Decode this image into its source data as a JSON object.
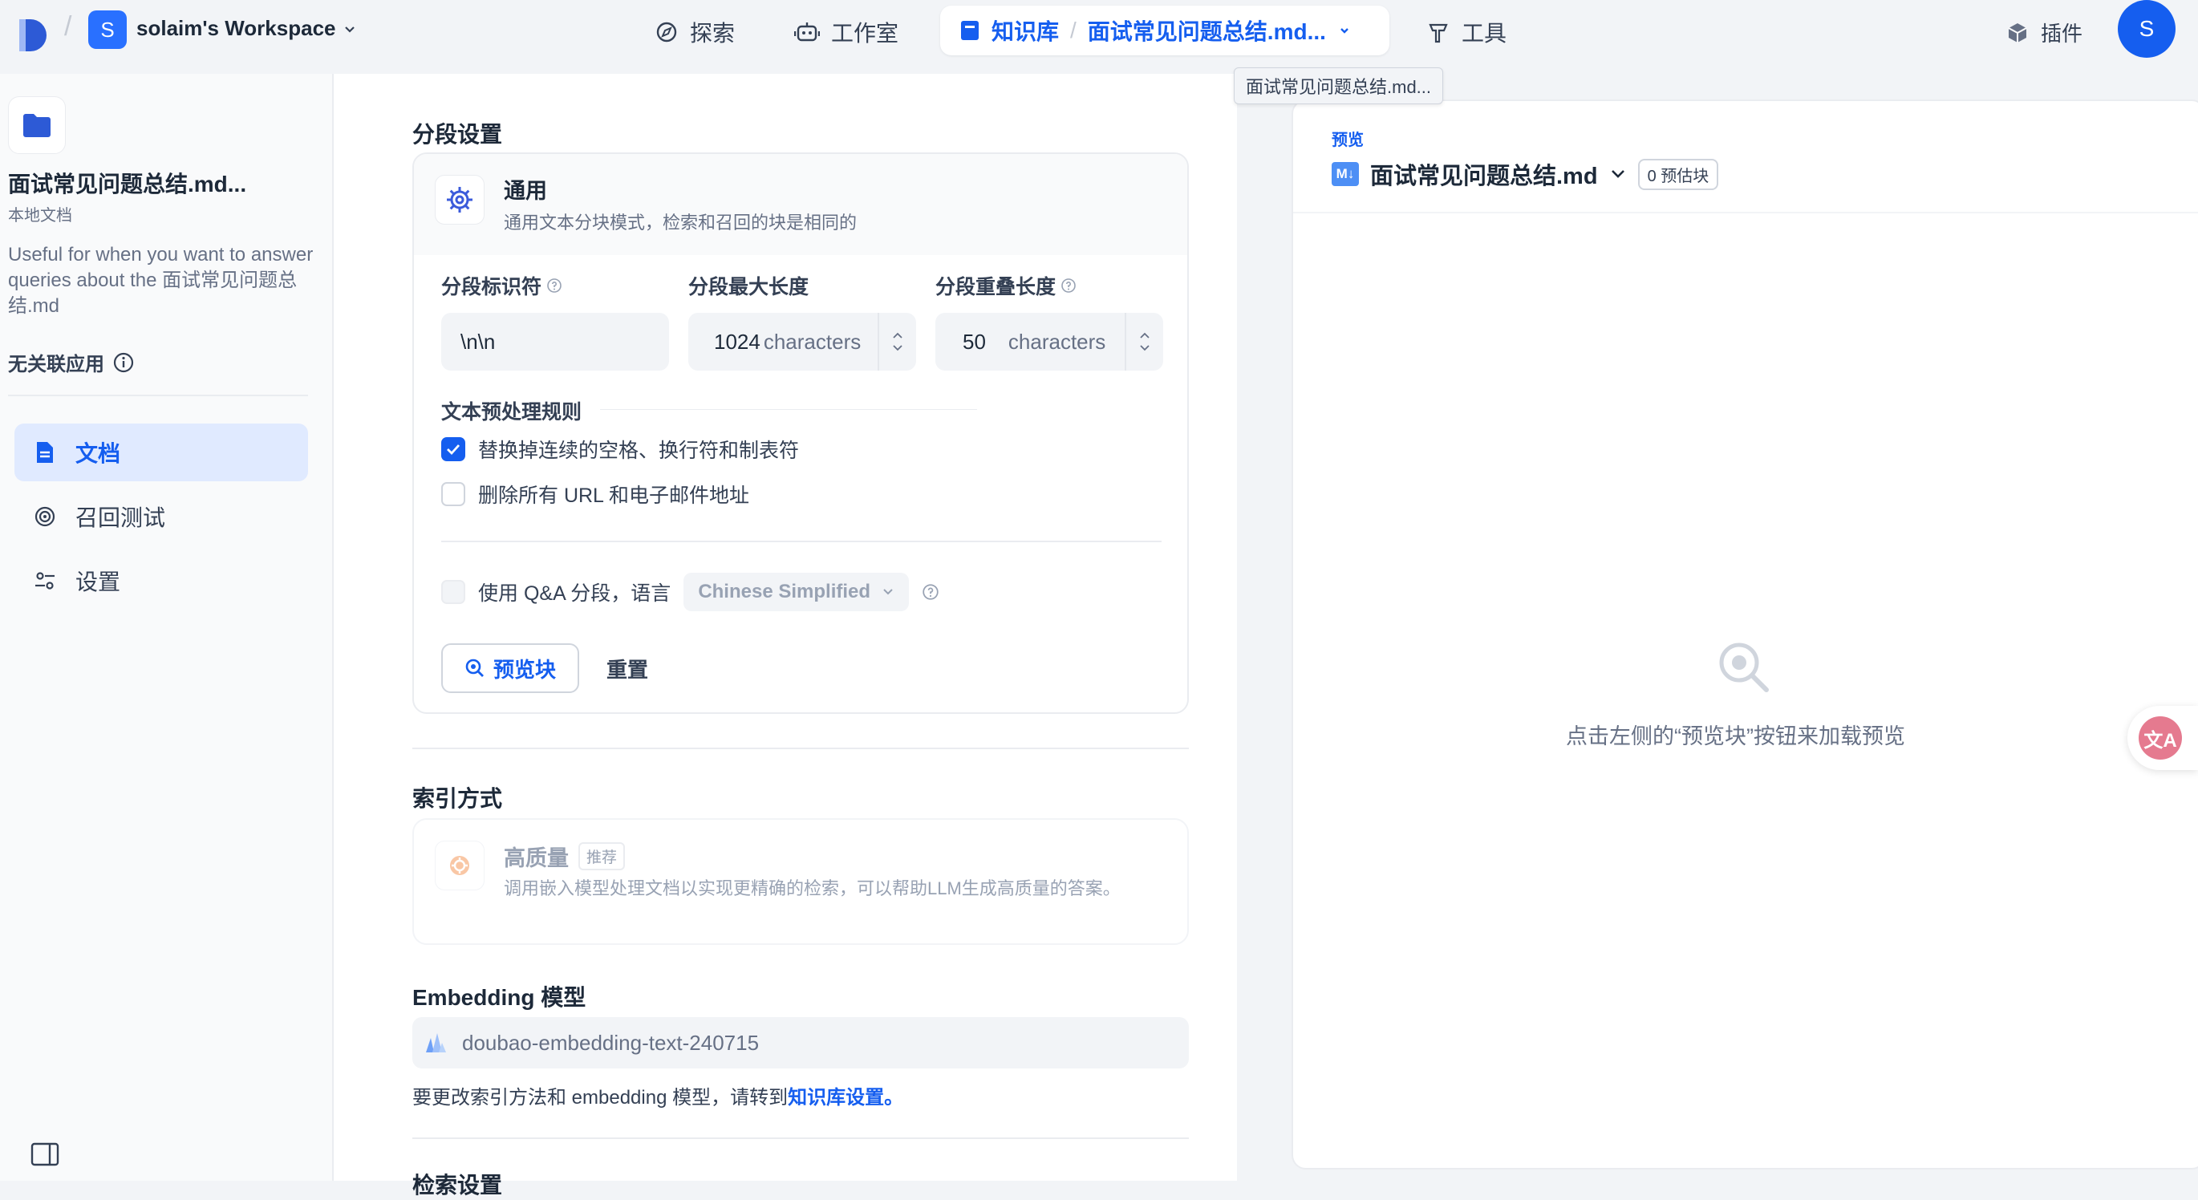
{
  "topbar": {
    "workspace_initial": "S",
    "workspace_name": "solaim's Workspace",
    "nav_explore": "探索",
    "nav_studio": "工作室",
    "nav_knowledge": "知识库",
    "nav_breadcrumb_doc": "面试常见问题总结.md...",
    "nav_tools": "工具",
    "plugins": "插件",
    "avatar_initial": "S",
    "tooltip": "面试常见问题总结.md..."
  },
  "sidebar": {
    "title": "面试常见问题总结.md...",
    "subtitle": "本地文档",
    "description": "Useful for when you want to answer queries about the 面试常见问题总结.md",
    "no_app": "无关联应用",
    "items": [
      {
        "label": "文档",
        "icon": "document-icon",
        "active": true
      },
      {
        "label": "召回测试",
        "icon": "target-icon",
        "active": false
      },
      {
        "label": "设置",
        "icon": "settings-sliders-icon",
        "active": false
      }
    ]
  },
  "segment": {
    "section_title": "分段设置",
    "mode_title": "通用",
    "mode_desc": "通用文本分块模式，检索和召回的块是相同的",
    "identifier_label": "分段标识符",
    "identifier_value": "\\n\\n",
    "max_len_label": "分段最大长度",
    "max_len_value": "1024",
    "max_len_unit": "characters",
    "overlap_label": "分段重叠长度",
    "overlap_value": "50",
    "overlap_unit": "characters",
    "rules_title": "文本预处理规则",
    "rule1": "替换掉连续的空格、换行符和制表符",
    "rule2": "删除所有 URL 和电子邮件地址",
    "qa_label": "使用 Q&A 分段，语言",
    "qa_language": "Chinese Simplified",
    "preview_button": "预览块",
    "reset_button": "重置"
  },
  "index": {
    "section_title": "索引方式",
    "hq_title": "高质量",
    "hq_badge": "推荐",
    "hq_desc": "调用嵌入模型处理文档以实现更精确的检索，可以帮助LLM生成高质量的答案。"
  },
  "embedding": {
    "section_title": "Embedding 模型",
    "model": "doubao-embedding-text-240715",
    "note_prefix": "要更改索引方法和 embedding 模型，请转到",
    "note_link": "知识库设置。",
    "next_section": "检索设置"
  },
  "preview": {
    "label": "预览",
    "file_name": "面试常见问题总结.md",
    "file_icon_text": "M↓",
    "badge": "0 预估块",
    "empty_text": "点击左侧的“预览块”按钮来加载预览",
    "translate_text": "文A"
  },
  "colors": {
    "accent": "#155eef",
    "workspace_badge": "#2970ff"
  }
}
